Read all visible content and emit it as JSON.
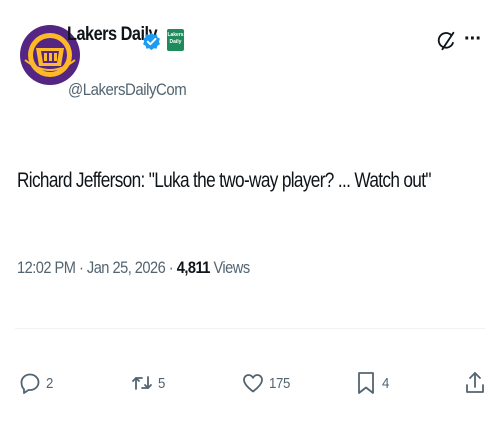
{
  "author": {
    "display_name": "Lakers Daily",
    "handle": "@LakersDailyCom",
    "avatar_icon": "lakers-logo-icon",
    "verified_icon": "verified-badge-icon",
    "affiliate_badge": "Lakers Daily",
    "colors": {
      "avatar_purple": "#552583",
      "avatar_gold": "#fdb927",
      "verified_blue": "#1d9bf0",
      "affiliate_green": "#1f8a5b"
    }
  },
  "header_actions": {
    "grok_icon": "grok-icon",
    "more_label": "···"
  },
  "tweet": {
    "text": "Richard Jefferson: \"Luka the two-way player? ... Watch out\""
  },
  "meta": {
    "time": "12:02 PM",
    "separator": " · ",
    "date": "Jan 25, 2026",
    "views_count": "4,811",
    "views_label": " Views"
  },
  "actions": {
    "reply": {
      "icon": "reply-icon",
      "count": "2"
    },
    "retweet": {
      "icon": "retweet-icon",
      "count": "5"
    },
    "like": {
      "icon": "heart-icon",
      "count": "175"
    },
    "bookmark": {
      "icon": "bookmark-icon",
      "count": "4"
    },
    "share": {
      "icon": "share-icon"
    }
  },
  "colors": {
    "text_primary": "#0f1419",
    "text_secondary": "#536471",
    "divider": "#eff3f4"
  }
}
